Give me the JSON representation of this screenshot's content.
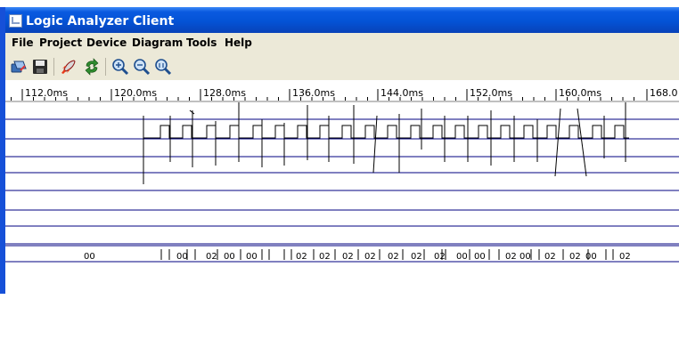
{
  "window": {
    "title": "Logic Analyzer Client"
  },
  "menu": [
    {
      "label": "File"
    },
    {
      "label": "Project"
    },
    {
      "label": "Device"
    },
    {
      "label": "Diagram"
    },
    {
      "label": "Tools"
    },
    {
      "label": "Help"
    }
  ],
  "toolbar": [
    {
      "icon": "open-link-icon"
    },
    {
      "icon": "save-icon"
    },
    {
      "icon": "rocket-run-icon"
    },
    {
      "icon": "refresh-icon"
    },
    {
      "icon": "zoom-in-icon"
    },
    {
      "icon": "zoom-out-icon"
    },
    {
      "icon": "zoom-reset-icon"
    }
  ],
  "timeline": {
    "labels": [
      "112.0ms",
      "120.0ms",
      "128.0ms",
      "136.0ms",
      "144.0ms",
      "152.0ms",
      "160.0ms",
      "168.0"
    ]
  },
  "bus": {
    "labels": [
      "00",
      "00",
      "02",
      "00",
      "00",
      "02",
      "02",
      "02",
      "02",
      "02",
      "02",
      "02",
      "00",
      "00",
      "02",
      "00",
      "02",
      "02",
      "00",
      "02"
    ]
  },
  "colors": {
    "title_bar": "#0453d6",
    "signal_line": "#000080",
    "trace": "#000000",
    "background": "#ece9d8"
  }
}
